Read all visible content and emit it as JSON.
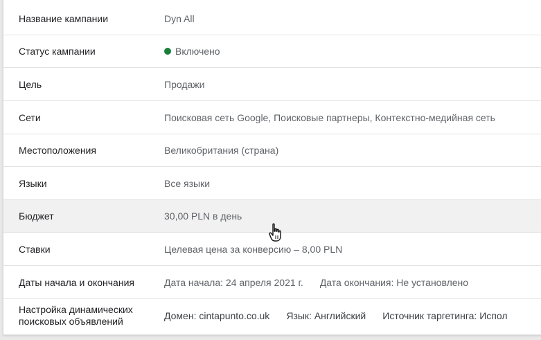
{
  "rows": [
    {
      "label": "Название кампании",
      "value": "Dyn All"
    },
    {
      "label": "Статус кампании",
      "value": "Включено",
      "status_color": "#188038"
    },
    {
      "label": "Цель",
      "value": "Продажи"
    },
    {
      "label": "Сети",
      "value": "Поисковая сеть Google, Поисковые партнеры, Контекстно-медийная сеть"
    },
    {
      "label": "Местоположения",
      "value": "Великобритания (страна)"
    },
    {
      "label": "Языки",
      "value": "Все языки"
    },
    {
      "label": "Бюджет",
      "value": "30,00 PLN в день"
    },
    {
      "label": "Ставки",
      "value": "Целевая цена за конверсию – 8,00 PLN"
    },
    {
      "label": "Даты начала и окончания",
      "start": "Дата начала: 24 апреля 2021 г.",
      "end": "Дата окончания: Не установлено"
    },
    {
      "label_line1": "Настройка динамических",
      "label_line2": "поисковых объявлений",
      "domain": "Домен: cintapunto.co.uk",
      "language": "Язык: Английский",
      "source": "Источник таргетинга: Испол"
    }
  ],
  "icons": {
    "cursor": "hand-pointer-icon"
  }
}
